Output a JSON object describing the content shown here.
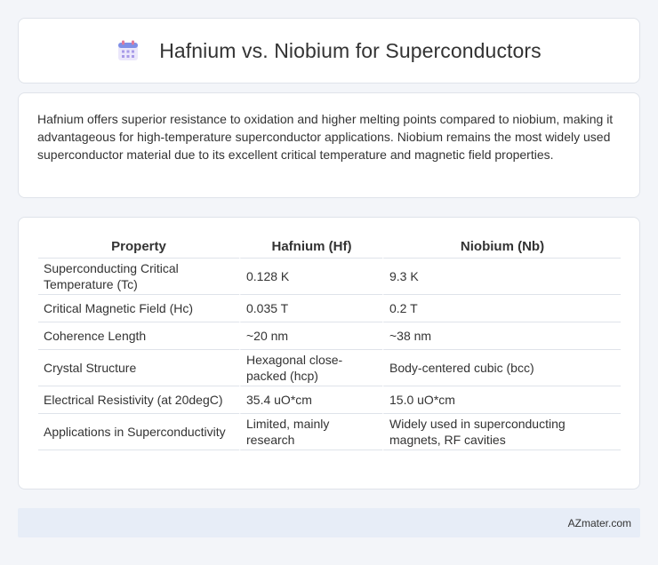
{
  "header": {
    "title": "Hafnium vs. Niobium for Superconductors",
    "icon": "calendar-icon"
  },
  "summary": {
    "text": "Hafnium offers superior resistance to oxidation and higher melting points compared to niobium, making it advantageous for high-temperature superconductor applications. Niobium remains the most widely used superconductor material due to its excellent critical temperature and magnetic field properties."
  },
  "table": {
    "headers": [
      "Property",
      "Hafnium (Hf)",
      "Niobium (Nb)"
    ],
    "rows": [
      [
        "Superconducting Critical Temperature (Tc)",
        "0.128 K",
        "9.3 K"
      ],
      [
        "Critical Magnetic Field (Hc)",
        "0.035 T",
        "0.2 T"
      ],
      [
        "Coherence Length",
        "~20 nm",
        "~38 nm"
      ],
      [
        "Crystal Structure",
        "Hexagonal close-packed (hcp)",
        "Body-centered cubic (bcc)"
      ],
      [
        "Electrical Resistivity (at 20degC)",
        "35.4 uO*cm",
        "15.0 uO*cm"
      ],
      [
        "Applications in Superconductivity",
        "Limited, mainly research",
        "Widely used in superconducting magnets, RF cavities"
      ]
    ]
  },
  "footer": {
    "brand": "AZmater.com"
  }
}
